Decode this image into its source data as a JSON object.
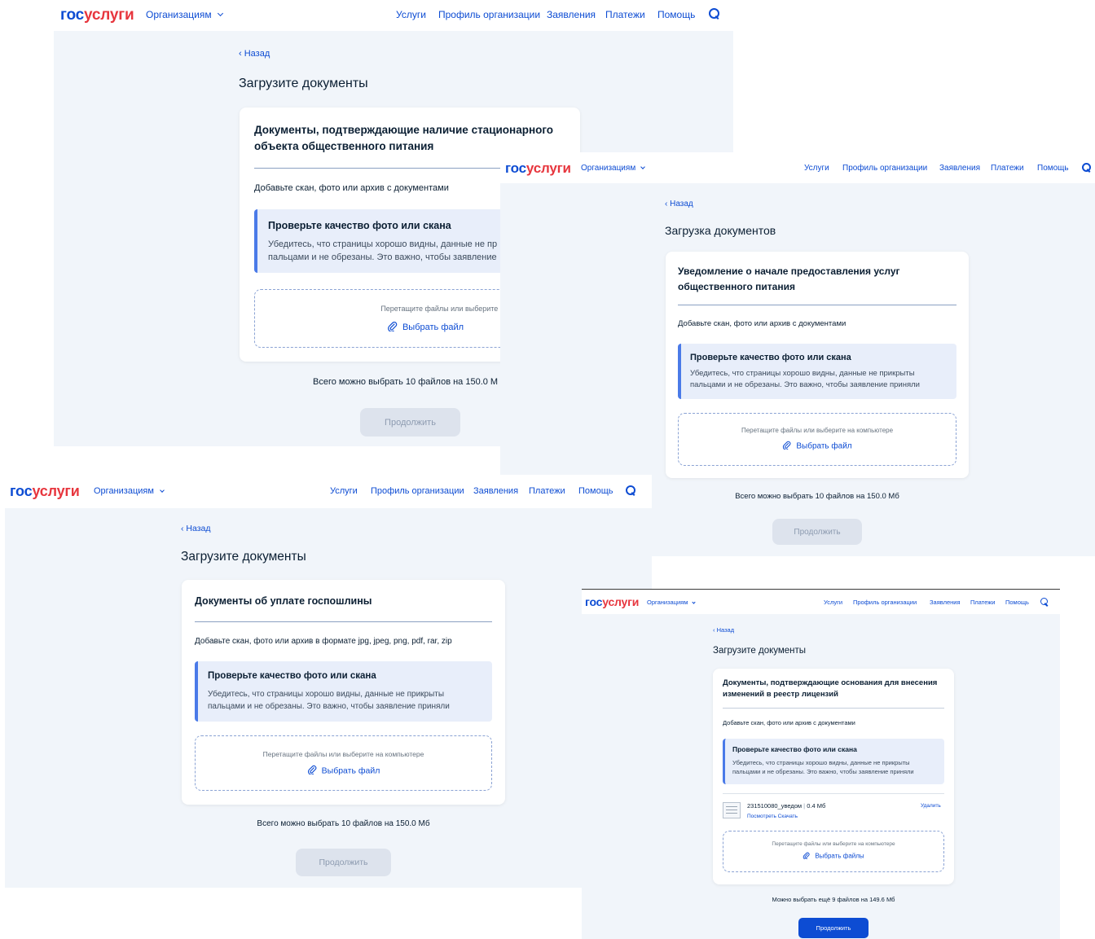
{
  "header": {
    "logo_part1": "гос",
    "logo_part2": "услуги",
    "org_menu": "Организациям",
    "nav": [
      "Услуги",
      "Профиль организации",
      "Заявления",
      "Платежи",
      "Помощь"
    ]
  },
  "common": {
    "back": "Назад",
    "warn_title": "Проверьте качество фото или скана",
    "warn_text": "Убедитесь, что страницы хорошо видны, данные не прикрыты пальцами и не обрезаны. Это важно, чтобы заявление приняли",
    "drop_text": "Перетащите файлы или выберите на компьютере",
    "continue": "Продолжить"
  },
  "screen1": {
    "title": "Загрузите документы",
    "card_title": "Документы, подтверждающие наличие стационарного объекта общественного питания",
    "hint": "Добавьте скан, фото или архив с документами",
    "warn_text": "Убедитесь, что страницы хорошо видны, данные не пр пальцами и не обрезаны. Это важно, чтобы заявление",
    "drop_text": "Перетащите файлы или выберите на компьютере",
    "choose": "Выбрать файл",
    "limit": "Всего можно выбрать 10 файлов на 150.0 М"
  },
  "screen2": {
    "title": "Загрузка документов",
    "card_title": "Уведомление о начале предоставления услуг общественного питания",
    "hint": "Добавьте скан, фото или архив с документами",
    "choose": "Выбрать файл",
    "limit": "Всего можно выбрать 10 файлов на 150.0 Мб"
  },
  "screen3": {
    "title": "Загрузите документы",
    "card_title": "Документы об уплате госпошлины",
    "hint": "Добавьте скан, фото или архив в формате jpg, jpeg, png, pdf, rar, zip",
    "choose": "Выбрать файл",
    "limit": "Всего можно выбрать 10 файлов на 150.0 Мб"
  },
  "screen4": {
    "title": "Загрузите документы",
    "card_title": "Документы, подтверждающие основания для внесения изменений в реестр лицензий",
    "hint": "Добавьте скан, фото или архив с документами",
    "file_name": "231510080_уведом",
    "file_size": "0.4 Мб",
    "file_view": "Посмотреть",
    "file_download": "Скачать",
    "file_delete": "Удалить",
    "choose": "Выбрать файлы",
    "limit": "Можно выбрать ещё 9 файлов на 149.6 Мб"
  },
  "colors": {
    "brand_blue": "#0d4cd3",
    "brand_red": "#e7363e",
    "page_bg": "#f1f5fa",
    "warning_bg": "#e8eefa",
    "disabled_btn": "#dde3ed"
  }
}
